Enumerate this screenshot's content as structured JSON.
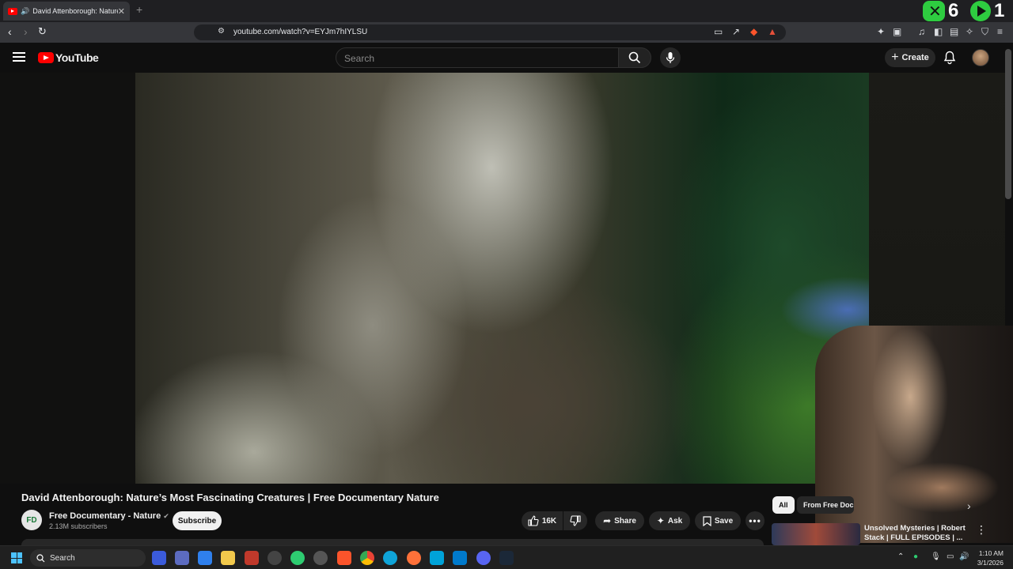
{
  "browser": {
    "tab_title": "David Attenborough: Nature",
    "url": "youtube.com/watch?v=EYJm7hIYLSU",
    "new_tab_label": "+",
    "ext_counter_1": "6",
    "ext_counter_2": "1"
  },
  "youtube": {
    "logo_text": "YouTube",
    "search_placeholder": "Search",
    "create_label": "Create"
  },
  "video": {
    "title": "David Attenborough: Nature’s Most Fascinating Creatures | Free Documentary Nature",
    "channel_name": "Free Documentary - Nature",
    "channel_initials": "FD",
    "subscribers": "2.13M subscribers",
    "subscribe_label": "Subscribe",
    "likes": "16K",
    "share_label": "Share",
    "ask_label": "Ask",
    "save_label": "Save"
  },
  "recommendations": {
    "chips": [
      "All",
      "From Free Doc"
    ],
    "items": [
      {
        "title": "Unsolved Mysteries | Robert Stack | FULL EPISODES | ..."
      }
    ]
  },
  "taskbar": {
    "search_label": "Search",
    "time": "1:10 AM",
    "date": "3/1/2026"
  },
  "colors": {
    "accent_red": "#ff0000",
    "background": "#0f0f0f",
    "windows_blue": "#4cc2ff"
  }
}
